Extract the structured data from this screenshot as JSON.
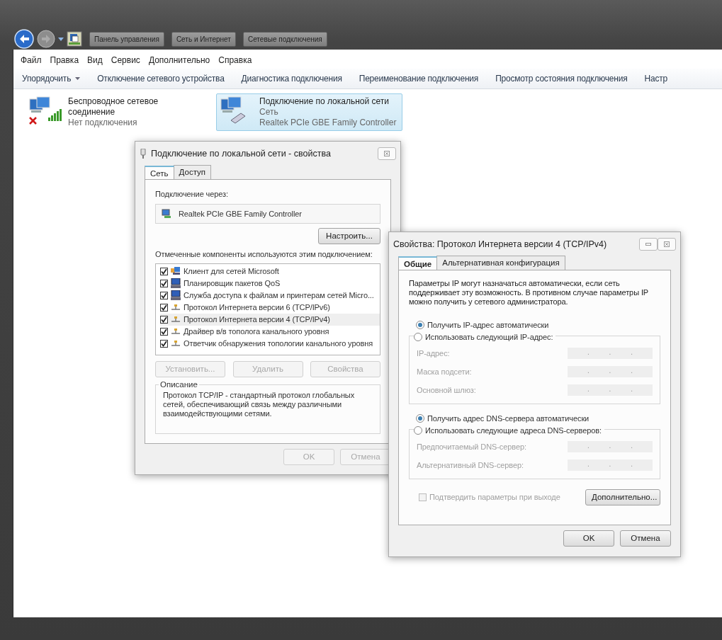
{
  "explorer": {
    "breadcrumbs": [
      "Панель управления",
      "Сеть и Интернет",
      "Сетевые подключения"
    ],
    "menu": [
      "Файл",
      "Правка",
      "Вид",
      "Сервис",
      "Дополнительно",
      "Справка"
    ],
    "toolbar": [
      {
        "label": "Упорядочить",
        "dropdown": true
      },
      {
        "label": "Отключение сетевого устройства",
        "dropdown": false
      },
      {
        "label": "Диагностика подключения",
        "dropdown": false
      },
      {
        "label": "Переименование подключения",
        "dropdown": false
      },
      {
        "label": "Просмотр состояния подключения",
        "dropdown": false
      },
      {
        "label": "Настр",
        "dropdown": false
      }
    ],
    "connections": [
      {
        "kind": "wireless",
        "name": "Беспроводное сетевое соединение",
        "status": "Нет подключения",
        "disconnected": true,
        "selected": false
      },
      {
        "kind": "wired",
        "name": "Подключение по локальной сети",
        "status": "Сеть",
        "adapter": "Realtek PCIe GBE Family Controller",
        "disconnected": false,
        "selected": true
      }
    ]
  },
  "lan_dialog": {
    "title": "Подключение по локальной сети - свойства",
    "tabs": [
      {
        "label": "Сеть",
        "selected": true
      },
      {
        "label": "Доступ",
        "selected": false
      }
    ],
    "connect_using_label": "Подключение через:",
    "adapter": "Realtek PCIe GBE Family Controller",
    "configure_button": "Настроить...",
    "components_label": "Отмеченные компоненты используются этим подключением:",
    "components": [
      {
        "kind": "client",
        "label": "Клиент для сетей Microsoft",
        "checked": true,
        "selected": false
      },
      {
        "kind": "service",
        "label": "Планировщик пакетов QoS",
        "checked": true,
        "selected": false
      },
      {
        "kind": "service",
        "label": "Служба доступа к файлам и принтерам сетей Micro...",
        "checked": true,
        "selected": false
      },
      {
        "kind": "protocol",
        "label": "Протокол Интернета версии 6 (TCP/IPv6)",
        "checked": true,
        "selected": false
      },
      {
        "kind": "protocol",
        "label": "Протокол Интернета версии 4 (TCP/IPv4)",
        "checked": true,
        "selected": true
      },
      {
        "kind": "protocol",
        "label": "Драйвер в/в тополога канального уровня",
        "checked": true,
        "selected": false
      },
      {
        "kind": "protocol",
        "label": "Ответчик обнаружения топологии канального уровня",
        "checked": true,
        "selected": false
      }
    ],
    "component_buttons": [
      {
        "label": "Установить...",
        "disabled": true
      },
      {
        "label": "Удалить",
        "disabled": true
      },
      {
        "label": "Свойства",
        "disabled": true
      }
    ],
    "description_title": "Описание",
    "description": "Протокол TCP/IP - стандартный протокол глобальных сетей, обеспечивающий связь между различными взаимодействующими сетями.",
    "buttons": [
      {
        "label": "OK",
        "disabled": true
      },
      {
        "label": "Отмена",
        "disabled": true
      }
    ]
  },
  "ipv4_dialog": {
    "title": "Свойства: Протокол Интернета версии 4 (TCP/IPv4)",
    "tabs": [
      {
        "label": "Общие",
        "selected": true
      },
      {
        "label": "Альтернативная конфигурация",
        "selected": false
      }
    ],
    "intro": "Параметры IP могут назначаться автоматически, если сеть поддерживает эту возможность. В противном случае параметры IP можно получить у сетевого администратора.",
    "groups": [
      {
        "options": [
          {
            "label": "Получить IP-адрес автоматически",
            "selected": true
          },
          {
            "label": "Использовать следующий IP-адрес:",
            "selected": false
          }
        ],
        "fields": [
          {
            "label": "IP-адрес:",
            "separators": [
              ".",
              ".",
              "."
            ]
          },
          {
            "label": "Маска подсети:",
            "separators": [
              ".",
              ".",
              "."
            ]
          },
          {
            "label": "Основной шлюз:",
            "separators": [
              ".",
              ".",
              "."
            ]
          }
        ]
      },
      {
        "options": [
          {
            "label": "Получить адрес DNS-сервера автоматически",
            "selected": true
          },
          {
            "label": "Использовать следующие адреса DNS-серверов:",
            "selected": false
          }
        ],
        "fields": [
          {
            "label": "Предпочитаемый DNS-сервер:",
            "separators": [
              ".",
              ".",
              "."
            ]
          },
          {
            "label": "Альтернативный DNS-сервер:",
            "separators": [
              ".",
              ".",
              "."
            ]
          }
        ]
      }
    ],
    "validate": {
      "label": "Подтвердить параметры при выходе",
      "checked": false,
      "disabled": true
    },
    "advanced_button": "Дополнительно...",
    "buttons": [
      {
        "label": "OK",
        "disabled": false
      },
      {
        "label": "Отмена",
        "disabled": false
      }
    ]
  }
}
